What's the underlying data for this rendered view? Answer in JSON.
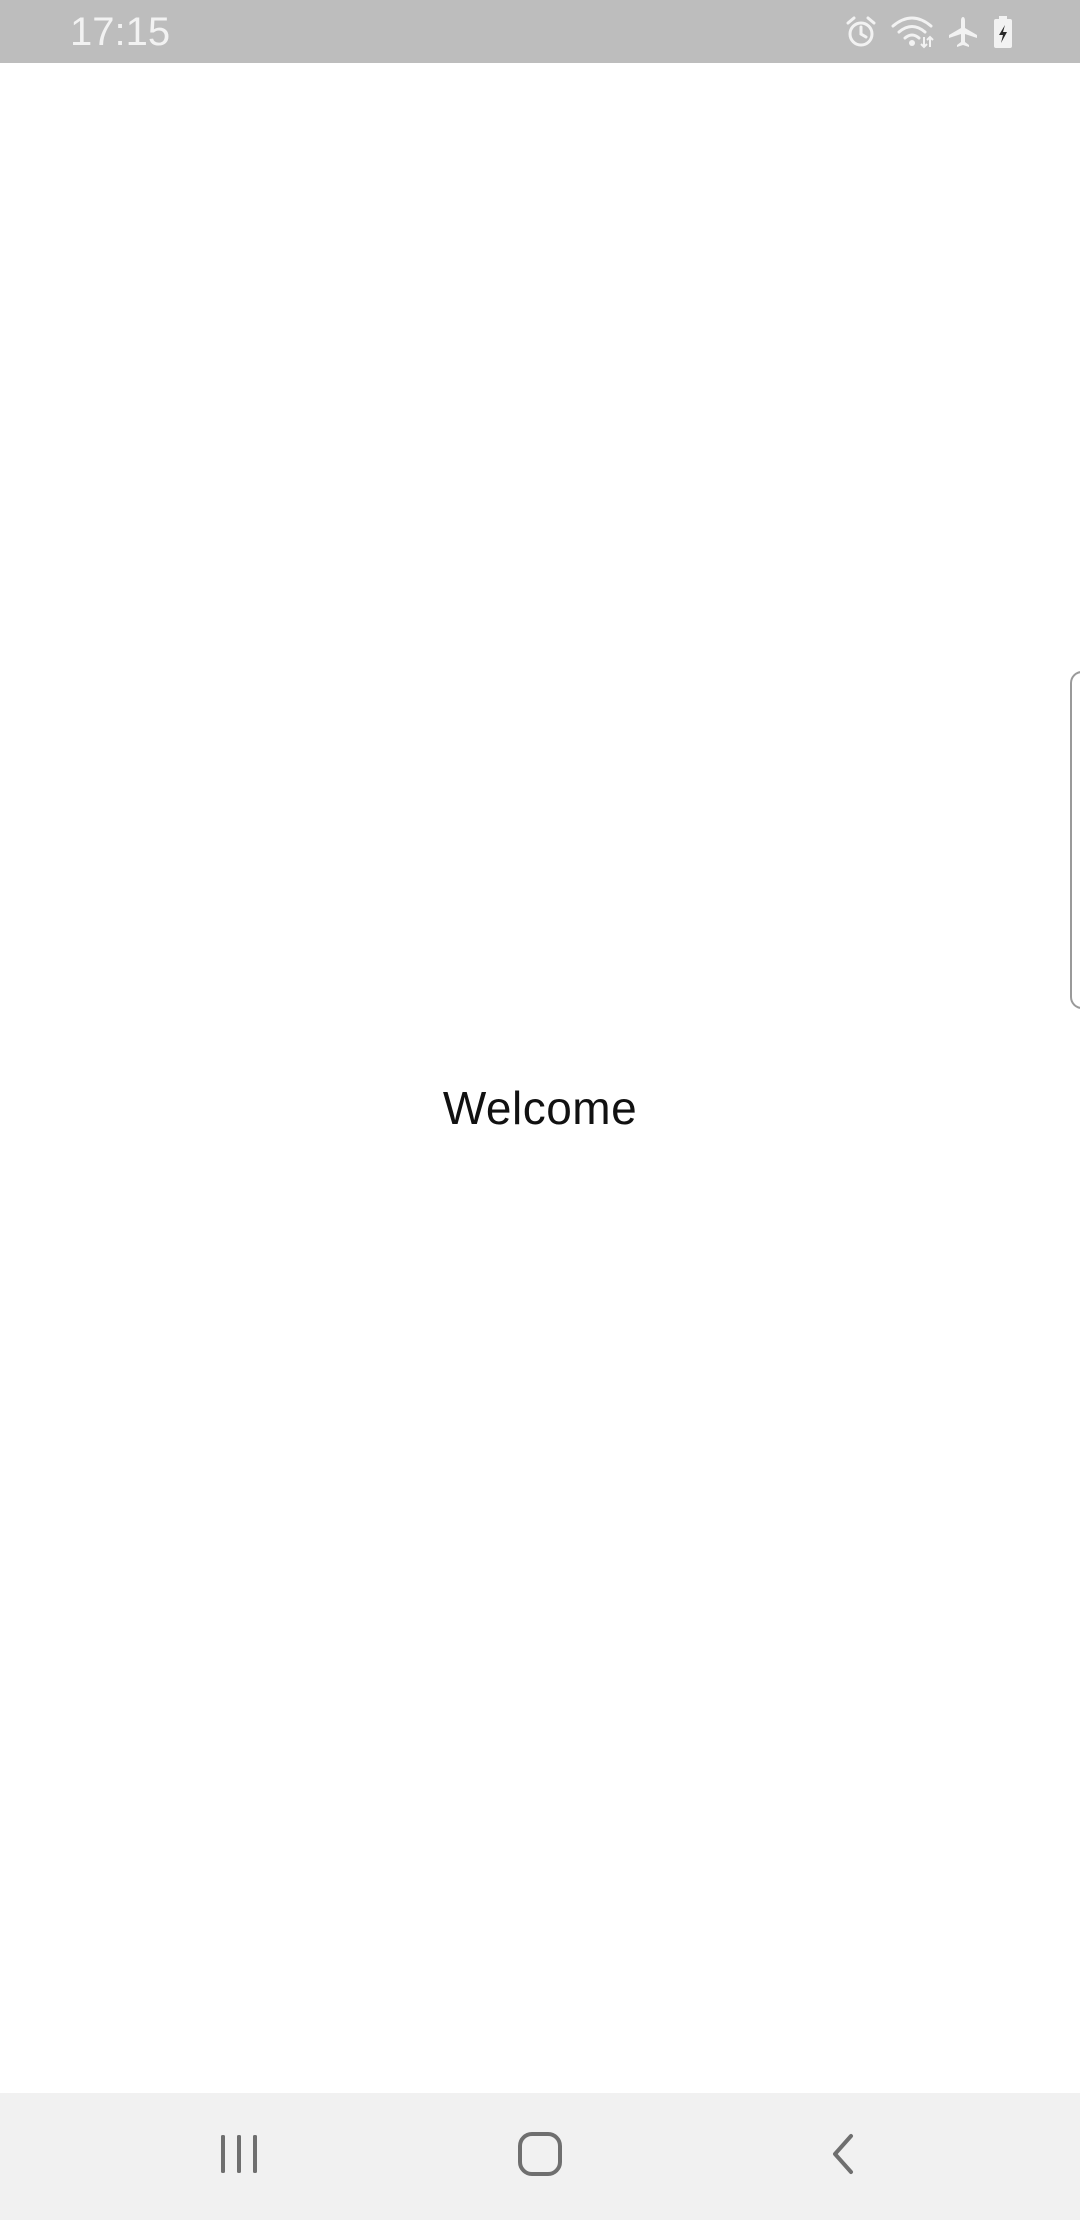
{
  "status_bar": {
    "time": "17:15",
    "icons": [
      "alarm-icon",
      "wifi-icon",
      "airplane-mode-icon",
      "battery-charging-icon"
    ],
    "background_color": "#bdbdbd",
    "icon_color": "#f2f2f2"
  },
  "main": {
    "welcome_text": "Welcome",
    "background_color": "#ffffff"
  },
  "navigation_bar": {
    "buttons": [
      "recents-icon",
      "home-icon",
      "back-icon"
    ],
    "background_color": "#f1f1f1",
    "icon_color": "#6f6f6f"
  }
}
